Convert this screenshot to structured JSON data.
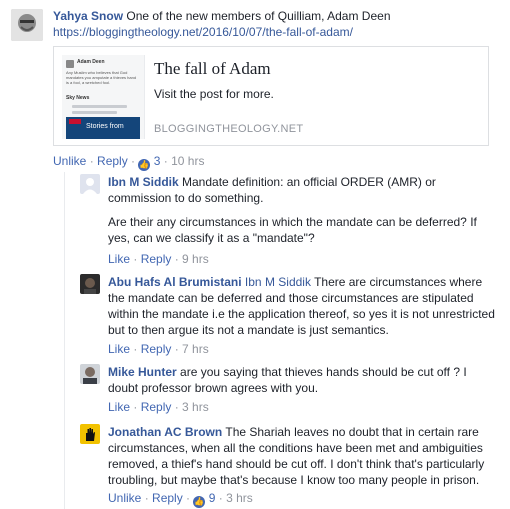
{
  "post": {
    "author": "Yahya Snow",
    "text": "One of the new members of Quilliam, Adam Deen",
    "url": "https://bloggingtheology.net/2016/10/07/the-fall-of-adam/",
    "card": {
      "title": "The fall of Adam",
      "description": "Visit the post for more.",
      "domain": "BLOGGINGTHEOLOGY.NET",
      "thumb_name": "Adam Deen",
      "thumb_text": "Any Muslim who believes that God mandates you amputate a thieves hand is a fool, a wretched fool.",
      "thumb_sky": "Sky News",
      "thumb_stories": "Stories from"
    },
    "actions": {
      "unlike": "Unlike",
      "reply": "Reply",
      "likes": "3",
      "time": "10 hrs"
    }
  },
  "replies": [
    {
      "author": "Ibn M Siddik",
      "lines": [
        "Mandate definition: an official ORDER (AMR) or",
        "commission to do something.",
        "",
        "Are their any circumstances in which the mandate can be deferred? If",
        "yes, can we classify it as a \"mandate\"?"
      ],
      "actions": {
        "like": "Like",
        "reply": "Reply",
        "time": "9 hrs"
      }
    },
    {
      "author": "Abu Hafs Al Brumistani",
      "mention": "Ibn M Siddik",
      "lines": [
        "There are circumstances where",
        "the mandate can be deferred and those circumstances are stipulated",
        "within the mandate i.e the application thereof, so yes it is not unrestricted",
        "but to then argue its not a mandate is just semantics."
      ],
      "actions": {
        "like": "Like",
        "reply": "Reply",
        "time": "7 hrs"
      }
    },
    {
      "author": "Mike Hunter",
      "lines": [
        "are you saying that thieves hands should be cut off ? I",
        "doubt professor brown agrees with you."
      ],
      "actions": {
        "like": "Like",
        "reply": "Reply",
        "time": "3 hrs"
      }
    },
    {
      "author": "Jonathan AC Brown",
      "lines": [
        "The Shariah leaves no doubt that in certain rare",
        "circumstances, when all the conditions have been met and ambiguities",
        "removed, a thief's hand should be cut off. I don't think that's particularly",
        "troubling, but maybe that's because I know too many people in prison."
      ],
      "actions": {
        "unlike": "Unlike",
        "reply": "Reply",
        "likes": "9",
        "time": "3 hrs"
      }
    }
  ],
  "colors": {
    "link": "#365899",
    "meta": "#90949c",
    "like_badge": "#4267b2"
  }
}
